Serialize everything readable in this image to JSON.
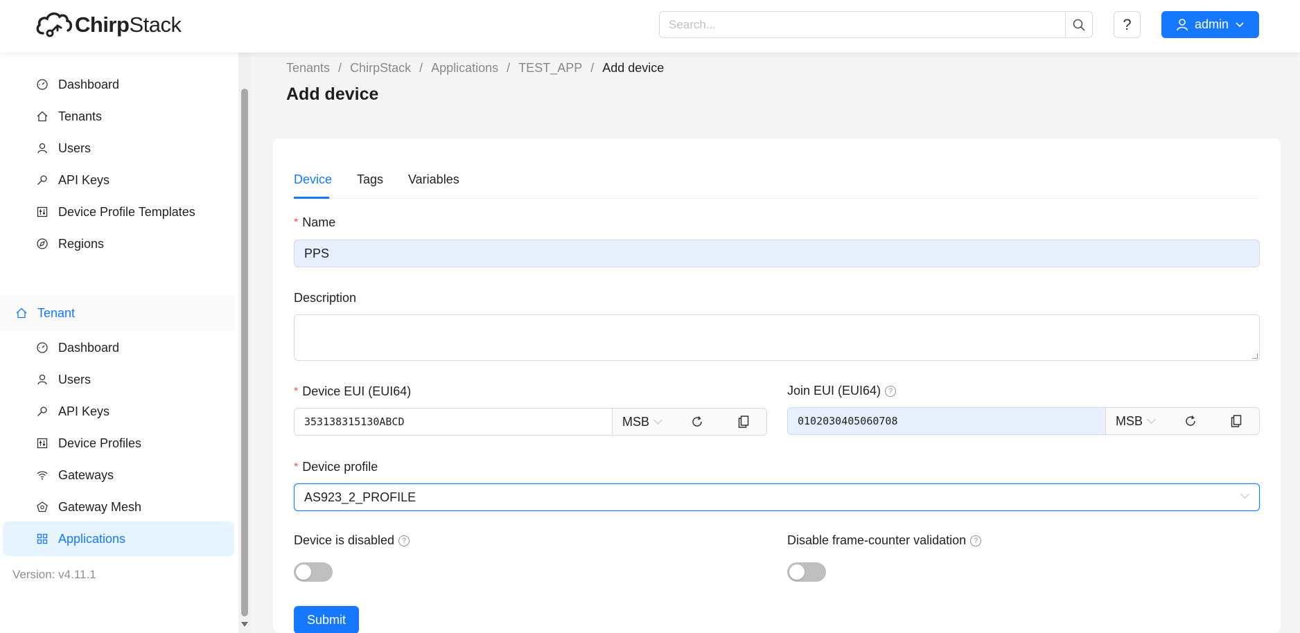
{
  "header": {
    "logo_bold": "Chirp",
    "logo_light": "Stack",
    "search_placeholder": "Search...",
    "help_label": "?",
    "user_label": "admin"
  },
  "sidebar": {
    "admin_items": [
      {
        "label": "Dashboard",
        "icon": "dashboard-icon"
      },
      {
        "label": "Tenants",
        "icon": "home-icon"
      },
      {
        "label": "Users",
        "icon": "user-icon"
      },
      {
        "label": "API Keys",
        "icon": "key-icon"
      },
      {
        "label": "Device Profile Templates",
        "icon": "profile-icon"
      },
      {
        "label": "Regions",
        "icon": "compass-icon"
      }
    ],
    "tenant_group": {
      "label": "Tenant",
      "icon": "home-icon"
    },
    "tenant_items": [
      {
        "label": "Dashboard",
        "icon": "dashboard-icon"
      },
      {
        "label": "Users",
        "icon": "user-icon"
      },
      {
        "label": "API Keys",
        "icon": "key-icon"
      },
      {
        "label": "Device Profiles",
        "icon": "profile-icon"
      },
      {
        "label": "Gateways",
        "icon": "wifi-icon"
      },
      {
        "label": "Gateway Mesh",
        "icon": "mesh-icon"
      },
      {
        "label": "Applications",
        "icon": "appstore-icon"
      }
    ],
    "version": "Version: v4.11.1"
  },
  "breadcrumb": [
    "Tenants",
    "ChirpStack",
    "Applications",
    "TEST_APP",
    "Add device"
  ],
  "breadcrumb_separator": "/",
  "page_title": "Add device",
  "tabs": [
    "Device",
    "Tags",
    "Variables"
  ],
  "form": {
    "required_mark": "*",
    "name_label": "Name",
    "name_value": "PPS",
    "description_label": "Description",
    "description_value": "",
    "dev_eui_label": "Device EUI (EUI64)",
    "dev_eui_value": "353138315130ABCD",
    "dev_eui_order": "MSB",
    "join_eui_label": "Join EUI (EUI64)",
    "join_eui_value": "0102030405060708",
    "join_eui_order": "MSB",
    "device_profile_label": "Device profile",
    "device_profile_value": "AS923_2_PROFILE",
    "disabled_label": "Device is disabled",
    "disabled_on": false,
    "fcnt_label": "Disable frame-counter validation",
    "fcnt_on": false,
    "help_mark": "?",
    "submit_label": "Submit"
  },
  "colors": {
    "primary": "#1677ff",
    "required": "#ff4d4f",
    "autofill": "#e8f0fe"
  }
}
